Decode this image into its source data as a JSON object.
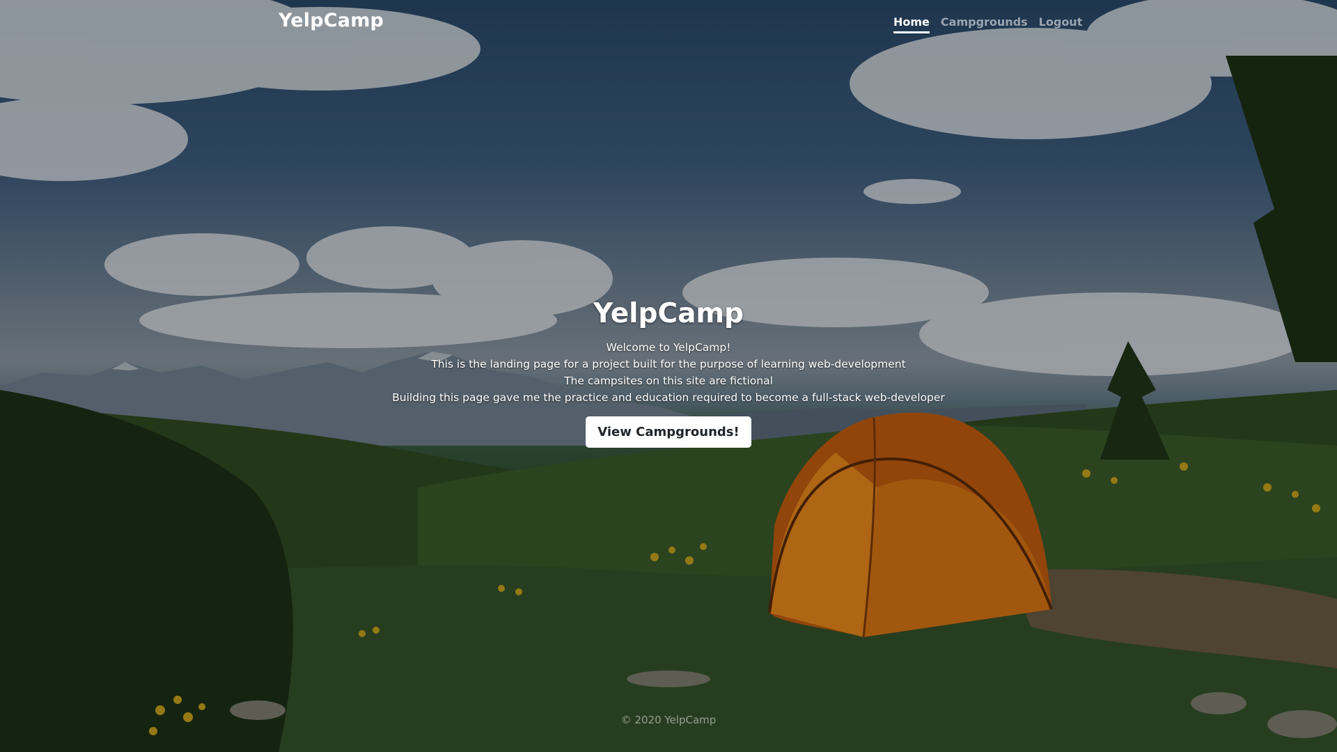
{
  "navbar": {
    "brand": "YelpCamp",
    "links": [
      {
        "label": "Home",
        "active": true
      },
      {
        "label": "Campgrounds",
        "active": false
      },
      {
        "label": "Logout",
        "active": false
      }
    ]
  },
  "hero": {
    "title": "YelpCamp",
    "lines": [
      "Welcome to YelpCamp!",
      "This is the landing page for a project built for the purpose of learning web-development",
      "The campsites on this site are fictional",
      "Building this page gave me the practice and education required to become a full-stack web-developer"
    ],
    "cta_label": "View Campgrounds!"
  },
  "footer": {
    "text": "© 2020 YelpCamp"
  },
  "colors": {
    "sky": "#294868",
    "tent": "#e8891c",
    "grass": "#3c5a2a",
    "button_bg": "#ffffff",
    "nav_inactive": "rgba(255,255,255,0.55)"
  }
}
